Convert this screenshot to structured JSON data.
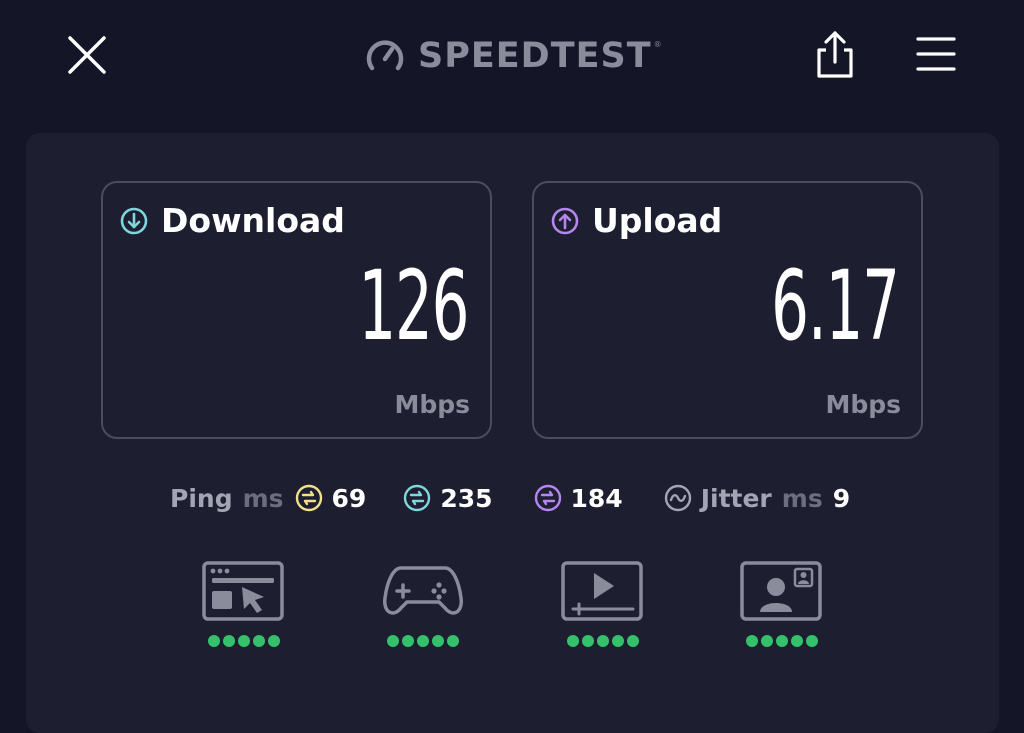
{
  "header": {
    "logo_text": "SPEEDTEST",
    "logo_mark": "®",
    "icons": {
      "close": "close-icon",
      "share": "share-icon",
      "menu": "menu-icon",
      "logo": "speedometer-icon"
    }
  },
  "download": {
    "label": "Download",
    "value": "126",
    "unit": "Mbps",
    "icon": "arrow-down-circle-icon",
    "accent": "#7fd6dc"
  },
  "upload": {
    "label": "Upload",
    "value": "6.17",
    "unit": "Mbps",
    "icon": "arrow-up-circle-icon",
    "accent": "#b486f0"
  },
  "ping": {
    "label": "Ping",
    "unit": "ms",
    "idle": {
      "value": "69",
      "color": "#f0e08a",
      "icon": "ping-idle-icon"
    },
    "download": {
      "value": "235",
      "color": "#7fd6dc",
      "icon": "ping-download-icon"
    },
    "upload": {
      "value": "184",
      "color": "#b486f0",
      "icon": "ping-upload-icon"
    }
  },
  "jitter": {
    "label": "Jitter",
    "unit": "ms",
    "value": "9",
    "icon": "jitter-icon"
  },
  "services": [
    {
      "name": "web-browsing",
      "icon": "browser-icon",
      "rating": 5
    },
    {
      "name": "gaming",
      "icon": "gamepad-icon",
      "rating": 5
    },
    {
      "name": "video-streaming",
      "icon": "video-play-icon",
      "rating": 5
    },
    {
      "name": "video-chat",
      "icon": "video-chat-icon",
      "rating": 5
    }
  ],
  "colors": {
    "background": "#141526",
    "panel": "#1d1e30",
    "rating_dot": "#35c06c"
  }
}
